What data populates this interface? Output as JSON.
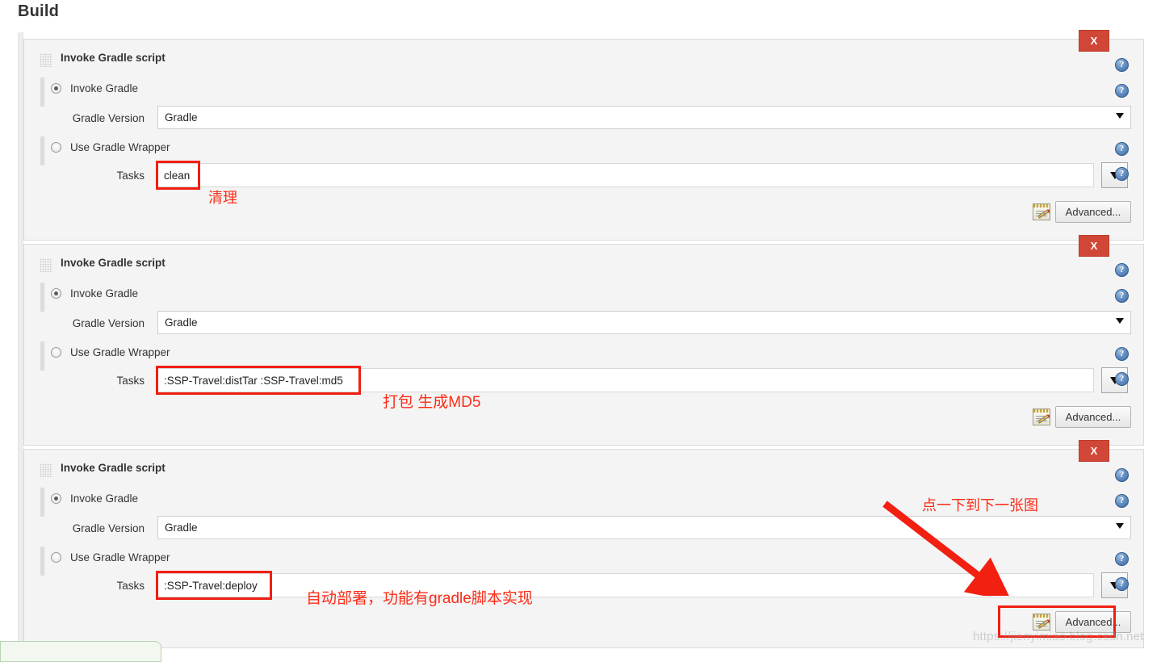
{
  "page": {
    "title": "Build",
    "watermark": "https://jienyimiao.blog.csdn.net"
  },
  "colors": {
    "annotation_red": "#fb2d18",
    "highlight_red": "#f01f12",
    "close_button_red": "#d14737",
    "help_blue": "#3c6ba5",
    "panel_bg": "#f4f4f4"
  },
  "common": {
    "block_title": "Invoke Gradle script",
    "radio_invoke_gradle": "Invoke Gradle",
    "radio_use_wrapper": "Use Gradle Wrapper",
    "label_gradle_version": "Gradle Version",
    "label_tasks": "Tasks",
    "gradle_version_value": "Gradle",
    "advanced_label": "Advanced...",
    "close_label": "X",
    "help_label": "?",
    "dropdown_glyph": "▼"
  },
  "builders": [
    {
      "title": "Invoke Gradle script",
      "invoke_selected": true,
      "gradle_version": "Gradle",
      "tasks_value": "clean",
      "tasks_highlight_width": 55,
      "advanced_label": "Advanced...",
      "annotation": "清理"
    },
    {
      "title": "Invoke Gradle script",
      "invoke_selected": true,
      "gradle_version": "Gradle",
      "tasks_value": ":SSP-Travel:distTar :SSP-Travel:md5",
      "tasks_highlight_width": 254,
      "advanced_label": "Advanced...",
      "annotation": "打包 生成MD5"
    },
    {
      "title": "Invoke Gradle script",
      "invoke_selected": true,
      "gradle_version": "Gradle",
      "tasks_value": ":SSP-Travel:deploy",
      "tasks_highlight_width": 144,
      "advanced_label": "Advanced...",
      "annotation": "自动部署，功能有gradle脚本实现"
    }
  ],
  "arrow_annotation": {
    "text": "点一下到下一张图"
  }
}
